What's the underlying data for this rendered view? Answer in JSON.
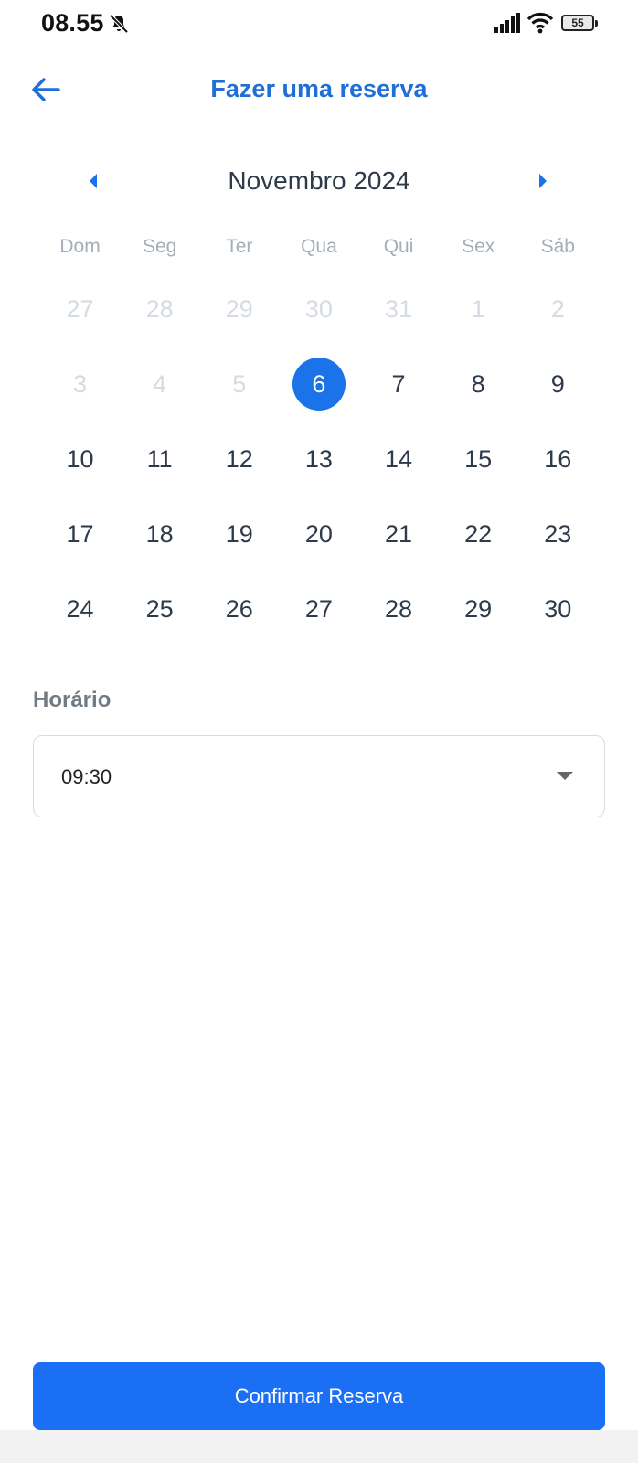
{
  "status_bar": {
    "time": "08.55",
    "battery": "55",
    "icons": [
      "bell-off-icon",
      "cellular-signal-icon",
      "wifi-icon",
      "battery-icon"
    ]
  },
  "header": {
    "title": "Fazer uma reserva",
    "back_icon": "arrow-left-icon"
  },
  "calendar": {
    "month_label": "Novembro 2024",
    "weekdays": [
      "Dom",
      "Seg",
      "Ter",
      "Qua",
      "Qui",
      "Sex",
      "Sáb"
    ],
    "days": [
      {
        "label": "27",
        "state": "muted"
      },
      {
        "label": "28",
        "state": "muted"
      },
      {
        "label": "29",
        "state": "muted"
      },
      {
        "label": "30",
        "state": "muted"
      },
      {
        "label": "31",
        "state": "muted"
      },
      {
        "label": "1",
        "state": "muted"
      },
      {
        "label": "2",
        "state": "muted"
      },
      {
        "label": "3",
        "state": "muted"
      },
      {
        "label": "4",
        "state": "muted"
      },
      {
        "label": "5",
        "state": "muted"
      },
      {
        "label": "6",
        "state": "selected"
      },
      {
        "label": "7",
        "state": "normal"
      },
      {
        "label": "8",
        "state": "normal"
      },
      {
        "label": "9",
        "state": "normal"
      },
      {
        "label": "10",
        "state": "normal"
      },
      {
        "label": "11",
        "state": "normal"
      },
      {
        "label": "12",
        "state": "normal"
      },
      {
        "label": "13",
        "state": "normal"
      },
      {
        "label": "14",
        "state": "normal"
      },
      {
        "label": "15",
        "state": "normal"
      },
      {
        "label": "16",
        "state": "normal"
      },
      {
        "label": "17",
        "state": "normal"
      },
      {
        "label": "18",
        "state": "normal"
      },
      {
        "label": "19",
        "state": "normal"
      },
      {
        "label": "20",
        "state": "normal"
      },
      {
        "label": "21",
        "state": "normal"
      },
      {
        "label": "22",
        "state": "normal"
      },
      {
        "label": "23",
        "state": "normal"
      },
      {
        "label": "24",
        "state": "normal"
      },
      {
        "label": "25",
        "state": "normal"
      },
      {
        "label": "26",
        "state": "normal"
      },
      {
        "label": "27",
        "state": "normal"
      },
      {
        "label": "28",
        "state": "normal"
      },
      {
        "label": "29",
        "state": "normal"
      },
      {
        "label": "30",
        "state": "normal"
      }
    ]
  },
  "time": {
    "label": "Horário",
    "value": "09:30"
  },
  "actions": {
    "confirm_label": "Confirmar Reserva"
  },
  "colors": {
    "accent": "#1a73e8",
    "title": "#1f6fd6",
    "text": "#2d3a4a",
    "muted": "#d5dbe2"
  }
}
